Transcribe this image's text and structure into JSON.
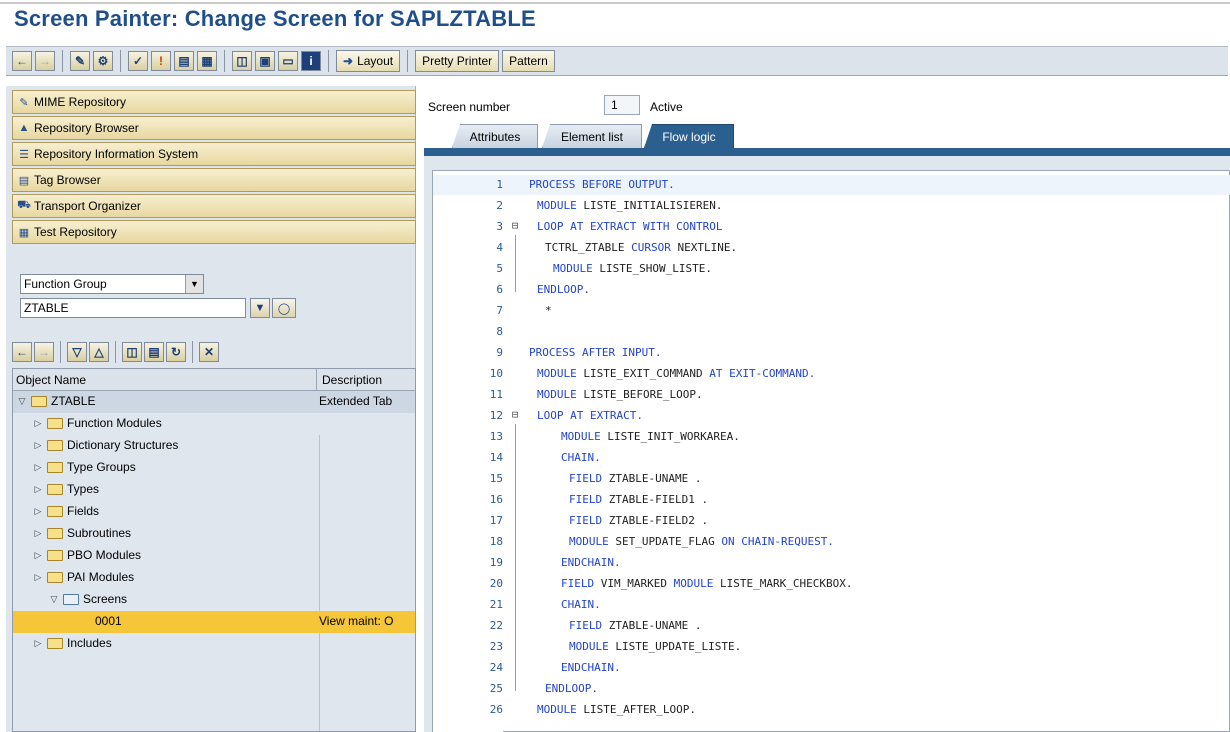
{
  "title": "Screen Painter: Change Screen for SAPLZTABLE",
  "toolbar": {
    "icons": [
      "back-arrow-icon",
      "forward-arrow-icon",
      "display-change-icon",
      "other-object-icon",
      "check-icon",
      "activate-icon",
      "where-used-icon",
      "hierarchy-icon",
      "layout-icon",
      "graphic-icon",
      "frame-icon",
      "info-icon"
    ],
    "layout_label": "Layout",
    "pretty_printer_label": "Pretty Printer",
    "pattern_label": "Pattern"
  },
  "nav": [
    {
      "label": "MIME Repository",
      "icon": "mime-icon"
    },
    {
      "label": "Repository Browser",
      "icon": "repository-icon"
    },
    {
      "label": "Repository Information System",
      "icon": "info-system-icon"
    },
    {
      "label": "Tag Browser",
      "icon": "tag-icon"
    },
    {
      "label": "Transport Organizer",
      "icon": "transport-icon"
    },
    {
      "label": "Test Repository",
      "icon": "test-icon"
    }
  ],
  "object_type": "Function Group",
  "object_name": "ZTABLE",
  "tree": {
    "col_name": "Object Name",
    "col_desc": "Description",
    "root": {
      "name": "ZTABLE",
      "desc": "Extended Tab"
    },
    "items": [
      {
        "name": "Function Modules"
      },
      {
        "name": "Dictionary Structures"
      },
      {
        "name": "Type Groups"
      },
      {
        "name": "Types"
      },
      {
        "name": "Fields"
      },
      {
        "name": "Subroutines"
      },
      {
        "name": "PBO Modules"
      },
      {
        "name": "PAI Modules"
      },
      {
        "name": "Screens"
      }
    ],
    "selected": {
      "name": "0001",
      "desc": "View maint: O"
    },
    "after": {
      "name": "Includes"
    }
  },
  "screen": {
    "number_label": "Screen number",
    "number": "1",
    "status": "Active"
  },
  "tabs": [
    "Attributes",
    "Element list",
    "Flow logic"
  ],
  "code": [
    {
      "n": "1",
      "t": "PROCESS BEFORE OUTPUT."
    },
    {
      "n": "2",
      "t": "MODULE LISTE_INITIALISIEREN."
    },
    {
      "n": "3",
      "t": "LOOP AT EXTRACT WITH CONTROL"
    },
    {
      "n": "4",
      "t": "TCTRL_ZTABLE CURSOR NEXTLINE."
    },
    {
      "n": "5",
      "t": "MODULE LISTE_SHOW_LISTE."
    },
    {
      "n": "6",
      "t": "ENDLOOP."
    },
    {
      "n": "7",
      "t": "*"
    },
    {
      "n": "8",
      "t": ""
    },
    {
      "n": "9",
      "t": "PROCESS AFTER INPUT."
    },
    {
      "n": "10",
      "t": "MODULE LISTE_EXIT_COMMAND AT EXIT-COMMAND."
    },
    {
      "n": "11",
      "t": "MODULE LISTE_BEFORE_LOOP."
    },
    {
      "n": "12",
      "t": "LOOP AT EXTRACT."
    },
    {
      "n": "13",
      "t": "MODULE LISTE_INIT_WORKAREA."
    },
    {
      "n": "14",
      "t": "CHAIN."
    },
    {
      "n": "15",
      "t": "FIELD ZTABLE-UNAME ."
    },
    {
      "n": "16",
      "t": "FIELD ZTABLE-FIELD1 ."
    },
    {
      "n": "17",
      "t": "FIELD ZTABLE-FIELD2 ."
    },
    {
      "n": "18",
      "t": "MODULE SET_UPDATE_FLAG ON CHAIN-REQUEST."
    },
    {
      "n": "19",
      "t": "ENDCHAIN."
    },
    {
      "n": "20",
      "t": "FIELD VIM_MARKED MODULE LISTE_MARK_CHECKBOX."
    },
    {
      "n": "21",
      "t": "CHAIN."
    },
    {
      "n": "22",
      "t": "FIELD ZTABLE-UNAME ."
    },
    {
      "n": "23",
      "t": "MODULE LISTE_UPDATE_LISTE."
    },
    {
      "n": "24",
      "t": "ENDCHAIN."
    },
    {
      "n": "25",
      "t": "ENDLOOP."
    },
    {
      "n": "26",
      "t": "MODULE LISTE_AFTER_LOOP."
    }
  ],
  "colors": {
    "title": "#1f4e8c",
    "active_tab": "#2b5f8f",
    "selected_row": "#f5c637",
    "keyword": "#2244cc"
  }
}
